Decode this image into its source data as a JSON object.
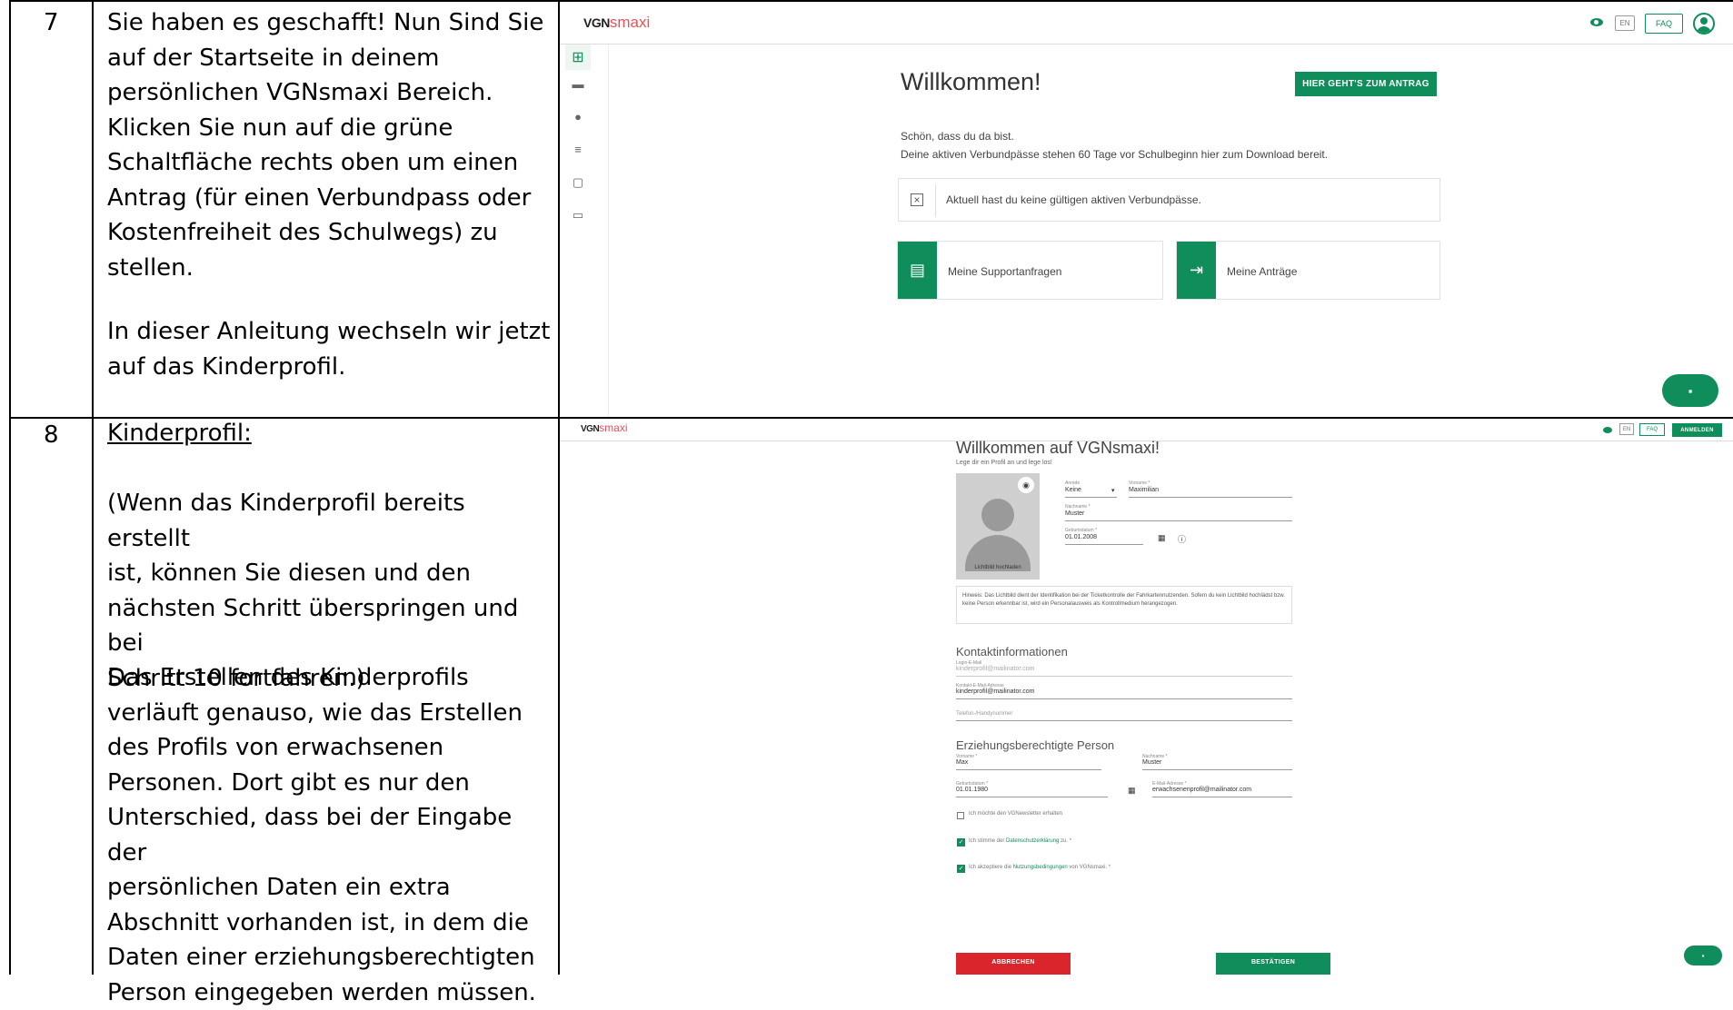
{
  "rows": [
    {
      "number": "7",
      "paragraphs": [
        "Sie haben es geschafft! Nun Sind Sie\nauf der Startseite in deinem\npersönlichen VGNsmaxi Bereich.\nKlicken Sie nun auf die grüne\nSchaltfläche rechts oben um einen\nAntrag (für einen Verbundpass oder\nKostenfreiheit des Schulwegs) zu\nstellen.",
        "In dieser Anleitung wechseln wir jetzt\nauf das Kinderprofil."
      ]
    },
    {
      "number": "8",
      "heading": "Kinderprofil:",
      "paragraphs": [
        "(Wenn das Kinderprofil bereits erstellt\nist, können Sie diesen und den\nnächsten Schritt überspringen und bei\nSchritt 10 fortfahren.)",
        "Das Erstellen des Kinderprofils\nverläuft genauso, wie das Erstellen\ndes Profils von erwachsenen\nPersonen. Dort gibt es nur den\nUnterschied, dass bei der Eingabe der\npersönlichen Daten ein extra\nAbschnitt vorhanden ist, in dem die\nDaten einer erziehungsberechtigten\nPerson eingegeben werden müssen."
      ]
    }
  ],
  "shot1": {
    "logo_vgn": "VGN",
    "logo_smaxi": "smaxi",
    "lang": "EN",
    "faq": "FAQ",
    "welcome": "Willkommen!",
    "cta": "HIER GEHT'S ZUM ANTRAG",
    "intro1": "Schön, dass du da bist.",
    "intro2": "Deine aktiven Verbundpässe stehen 60 Tage vor Schulbeginn hier zum Download bereit.",
    "nopass": "Aktuell hast du keine gültigen aktiven Verbundpässe.",
    "tile1": "Meine Supportanfragen",
    "tile2": "Meine Anträge",
    "accent": "#0f8d5a"
  },
  "shot2": {
    "logo_vgn": "VGN",
    "logo_smaxi": "smaxi",
    "lang": "EN",
    "faq": "FAQ",
    "login": "ANMELDEN",
    "title": "Willkommen auf VGNsmaxi!",
    "subtitle": "Lege dir ein Profil an und lege los!",
    "photo_label": "Lichtbild hochladen",
    "anrede_label": "Anrede",
    "anrede_value": "Keine",
    "vorname_label": "Vorname *",
    "vorname_value": "Maximilian",
    "nachname_label": "Nachname *",
    "nachname_value": "Muster",
    "geb_label": "Geburtsdatum *",
    "geb_value": "01.01.2008",
    "hint": "Hinweis: Das Lichtbild dient der Identifikation bei der Ticketkontrolle der Fahrkartennutzenden. Sofern du kein Lichtbild hochlädst bzw. keine Person erkennbar ist, wird ein Personalausweis als Kontrollmedium herangezogen.",
    "contact_title": "Kontaktinformationen",
    "login_label": "Login-E-Mail",
    "login_value": "kinderprofil@mailinator.com",
    "kemail_label": "Kontakt-E-Mail-Adresse",
    "kemail_value": "kinderprofil@mailinator.com",
    "phone_label": "Telefon-/Handynummer",
    "guardian_title": "Erziehungsberechtigte Person",
    "g_vorname_label": "Vorname *",
    "g_vorname_value": "Max",
    "g_nachname_label": "Nachname *",
    "g_nachname_value": "Muster",
    "g_geb_label": "Geburtsdatum *",
    "g_geb_value": "01.01.1980",
    "g_email_label": "E-Mail-Adresse *",
    "g_email_value": "erwachsenenprofil@mailinator.com",
    "newsletter": "Ich möchte den VGNewsletter erhalten",
    "privacy_pre": "Ich stimme der ",
    "privacy_link": "Datenschutzerklärung",
    "privacy_post": " zu. *",
    "terms_pre": "Ich akzeptiere die ",
    "terms_link": "Nutzungsbedingungen",
    "terms_post": " von VGNsmaxi. *",
    "cancel": "ABBRECHEN",
    "confirm": "BESTÄTIGEN",
    "cancel_color": "#d9252b"
  }
}
